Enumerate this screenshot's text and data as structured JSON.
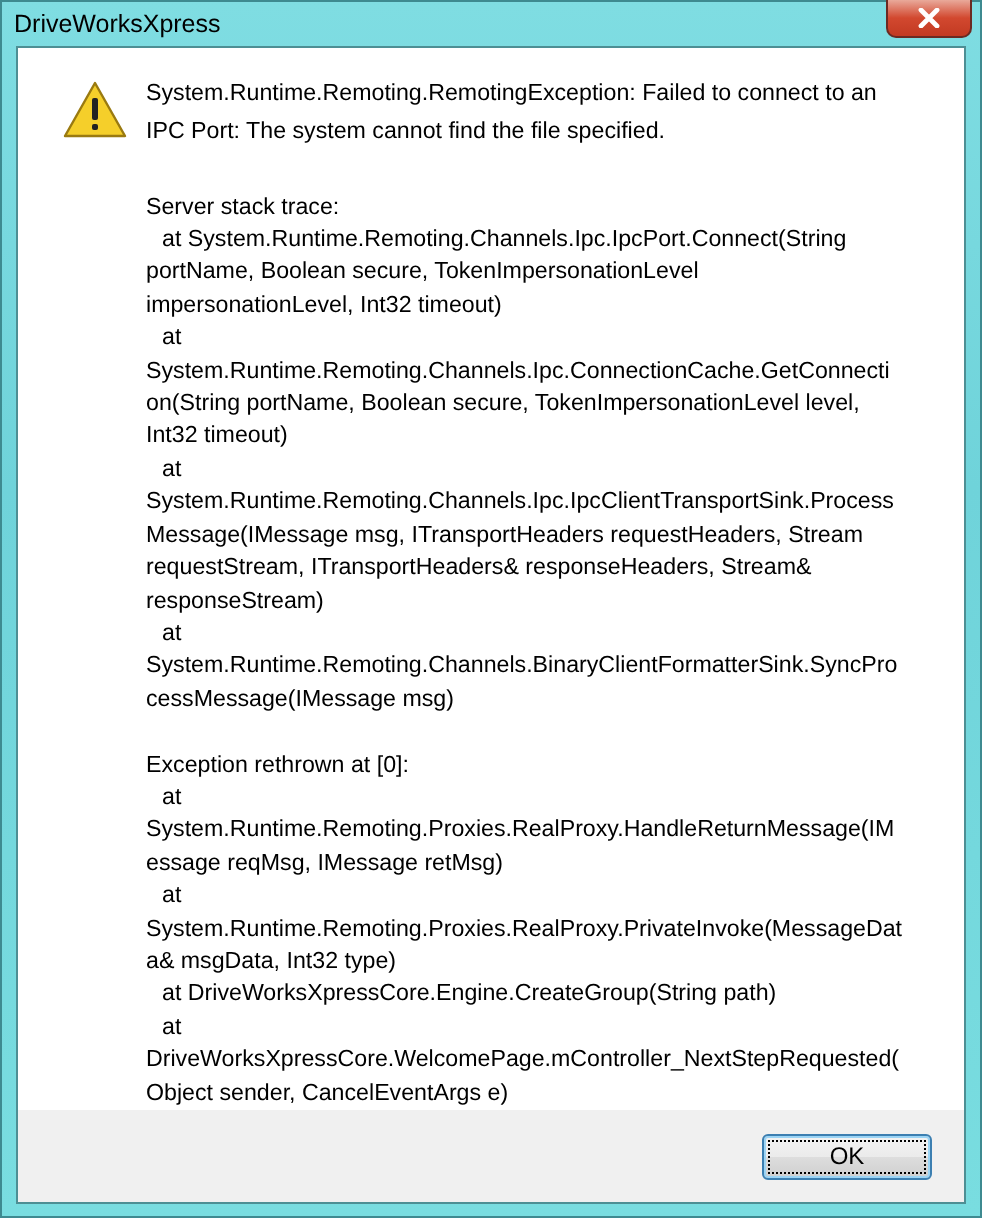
{
  "window": {
    "title": "DriveWorksXpress"
  },
  "message": [
    "System.Runtime.Remoting.RemotingException: Failed to connect to an",
    "IPC Port: The system cannot find the file specified."
  ],
  "details": [
    {
      "lines": [
        {
          "text": "Server stack trace:",
          "indent": false
        },
        {
          "text": "at System.Runtime.Remoting.Channels.Ipc.IpcPort.Connect(String",
          "indent": true
        },
        {
          "text": "portName, Boolean secure, TokenImpersonationLevel",
          "indent": false
        },
        {
          "text": "impersonationLevel, Int32 timeout)",
          "indent": false
        },
        {
          "text": "at",
          "indent": true
        },
        {
          "text": "System.Runtime.Remoting.Channels.Ipc.ConnectionCache.GetConnecti",
          "indent": false
        },
        {
          "text": "on(String portName, Boolean secure, TokenImpersonationLevel level,",
          "indent": false
        },
        {
          "text": "Int32 timeout)",
          "indent": false
        },
        {
          "text": "at",
          "indent": true
        },
        {
          "text": "System.Runtime.Remoting.Channels.Ipc.IpcClientTransportSink.Process",
          "indent": false
        },
        {
          "text": "Message(IMessage msg, ITransportHeaders requestHeaders, Stream",
          "indent": false
        },
        {
          "text": "requestStream, ITransportHeaders& responseHeaders, Stream&",
          "indent": false
        },
        {
          "text": "responseStream)",
          "indent": false
        },
        {
          "text": "at",
          "indent": true
        },
        {
          "text": "System.Runtime.Remoting.Channels.BinaryClientFormatterSink.SyncPro",
          "indent": false
        },
        {
          "text": "cessMessage(IMessage msg)",
          "indent": false
        }
      ]
    },
    {
      "lines": [
        {
          "text": "Exception rethrown at [0]:",
          "indent": false
        },
        {
          "text": "at",
          "indent": true
        },
        {
          "text": "System.Runtime.Remoting.Proxies.RealProxy.HandleReturnMessage(IM",
          "indent": false
        },
        {
          "text": "essage reqMsg, IMessage retMsg)",
          "indent": false
        },
        {
          "text": "at",
          "indent": true
        },
        {
          "text": "System.Runtime.Remoting.Proxies.RealProxy.PrivateInvoke(MessageDat",
          "indent": false
        },
        {
          "text": "a& msgData, Int32 type)",
          "indent": false
        },
        {
          "text": "at DriveWorksXpressCore.Engine.CreateGroup(String path)",
          "indent": true
        },
        {
          "text": "at",
          "indent": true
        },
        {
          "text": "DriveWorksXpressCore.WelcomePage.mController_NextStepRequested(",
          "indent": false
        },
        {
          "text": "Object sender, CancelEventArgs e)",
          "indent": false
        }
      ]
    }
  ],
  "buttons": [
    {
      "label": "OK",
      "default": true
    }
  ]
}
